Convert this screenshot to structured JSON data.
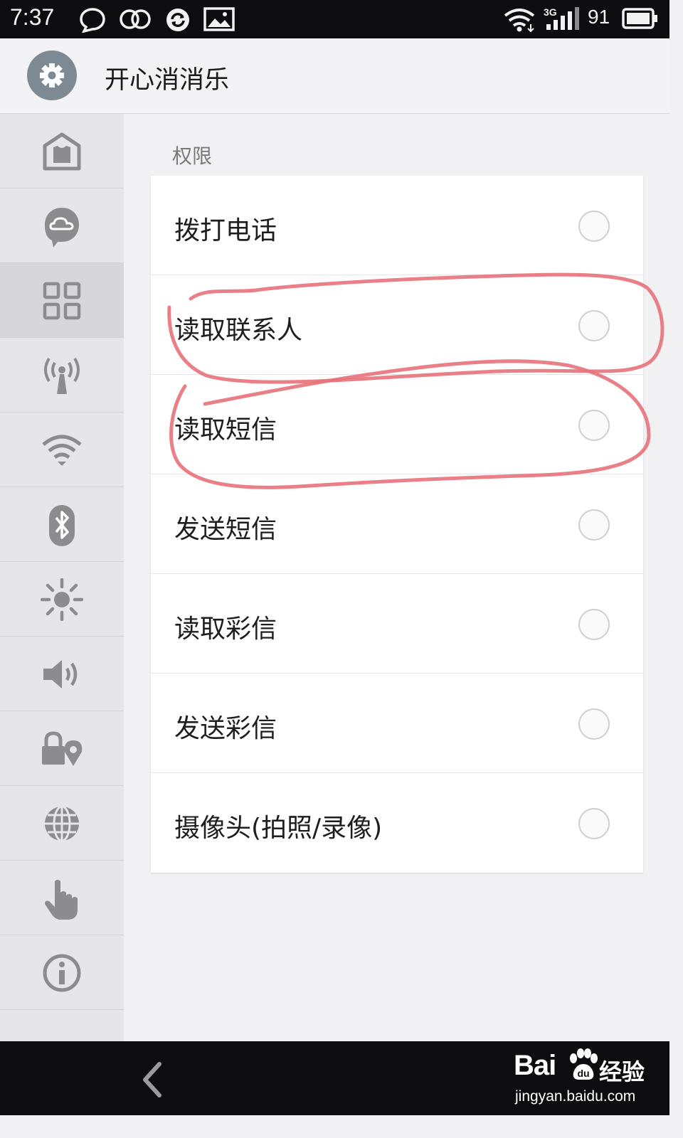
{
  "status_bar": {
    "time": "7:37",
    "battery_level": "91",
    "network_type": "3G",
    "icons": [
      "chat-bubble-icon",
      "circles-icon",
      "sync-icon",
      "image-icon",
      "wifi-icon",
      "signal-icon",
      "battery-icon"
    ]
  },
  "header": {
    "app_icon": "gear-icon",
    "title": "开心消消乐"
  },
  "sidebar": {
    "items": [
      {
        "icon": "home-shirt-icon",
        "active": false
      },
      {
        "icon": "cloud-chat-icon",
        "active": false
      },
      {
        "icon": "grid-icon",
        "active": true
      },
      {
        "icon": "antenna-icon",
        "active": false
      },
      {
        "icon": "wifi-icon",
        "active": false
      },
      {
        "icon": "bluetooth-icon",
        "active": false
      },
      {
        "icon": "brightness-icon",
        "active": false
      },
      {
        "icon": "volume-icon",
        "active": false
      },
      {
        "icon": "lock-location-icon",
        "active": false
      },
      {
        "icon": "globe-icon",
        "active": false
      },
      {
        "icon": "hand-pointer-icon",
        "active": false
      },
      {
        "icon": "info-icon",
        "active": false
      }
    ]
  },
  "permissions": {
    "section_title": "权限",
    "items": [
      {
        "label": "拨打电话",
        "checked": false
      },
      {
        "label": "读取联系人",
        "checked": false
      },
      {
        "label": "读取短信",
        "checked": false
      },
      {
        "label": "发送短信",
        "checked": false
      },
      {
        "label": "读取彩信",
        "checked": false
      },
      {
        "label": "发送彩信",
        "checked": false
      },
      {
        "label": "摄像头(拍照/录像)",
        "checked": false
      }
    ]
  },
  "nav_bar": {
    "back_icon": "chevron-left-icon"
  },
  "watermark": {
    "brand": "Bai",
    "brand_mark": "paw-icon",
    "suffix": "经验",
    "url": "jingyan.baidu.com"
  },
  "colors": {
    "status_bar_bg": "#0d0c11",
    "sidebar_bg": "#e6e5e8",
    "sidebar_active_bg": "#d7d6da",
    "icon_gray": "#8c8c90",
    "annotation_red": "#e8727a"
  }
}
